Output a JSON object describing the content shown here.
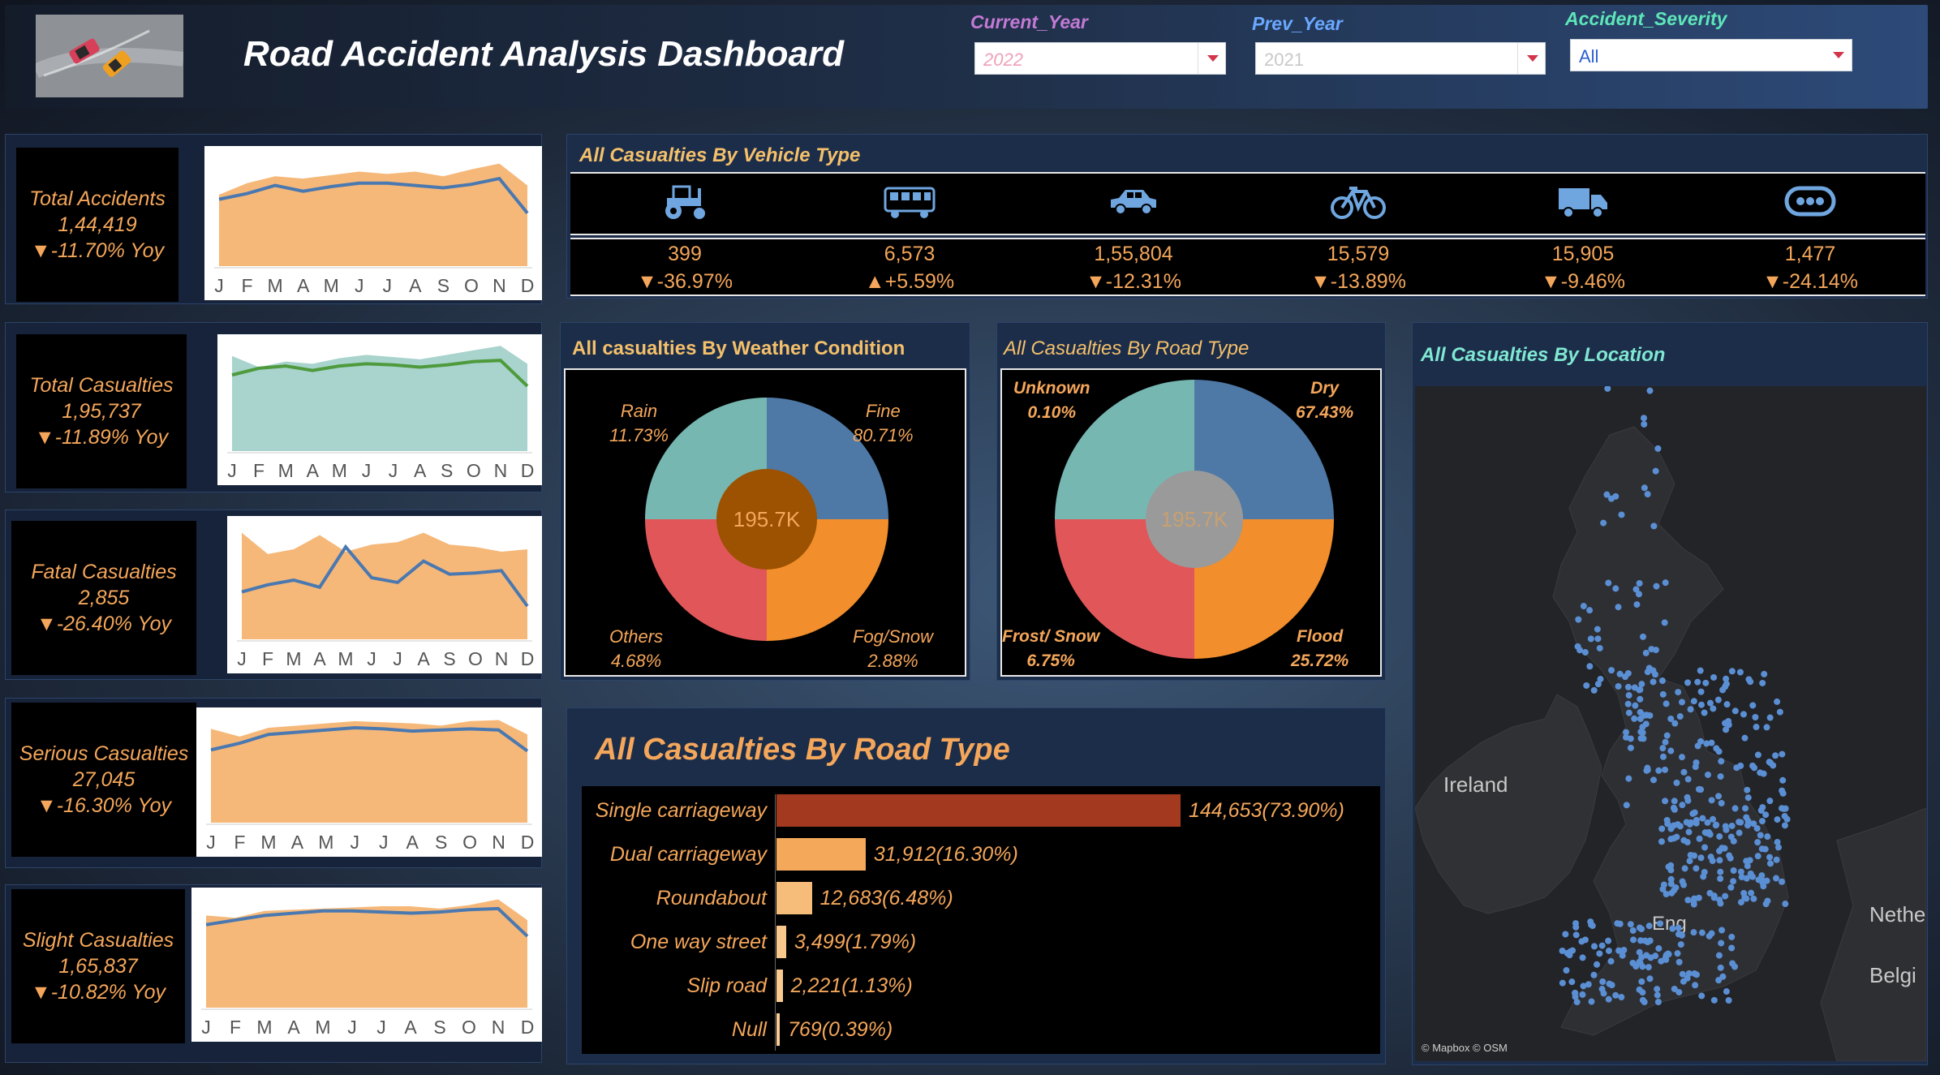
{
  "header": {
    "title": "Road Accident Analysis Dashboard",
    "filters": [
      {
        "label": "Current_Year",
        "value": "2022",
        "label_color": "#c37ad4",
        "value_color": "#f0a0b8"
      },
      {
        "label": "Prev_Year",
        "value": "2021",
        "label_color": "#6aa8ff",
        "value_color": "#c8c8c8"
      },
      {
        "label": "Accident_Severity",
        "value": "All",
        "label_color": "#5ee6b8",
        "value_color": "#2b5fd0"
      }
    ]
  },
  "months": [
    "J",
    "F",
    "M",
    "A",
    "M",
    "J",
    "J",
    "A",
    "S",
    "O",
    "N",
    "D"
  ],
  "kpis": [
    {
      "title": "Total Accidents",
      "value": "1,44,419",
      "change": "▼-11.70% Yoy",
      "area_color": "#f4b06a",
      "line_color": "#4a78b0",
      "area": [
        0.62,
        0.72,
        0.78,
        0.76,
        0.79,
        0.82,
        0.8,
        0.82,
        0.78,
        0.84,
        0.89,
        0.7
      ],
      "line": [
        0.58,
        0.63,
        0.7,
        0.65,
        0.69,
        0.72,
        0.72,
        0.7,
        0.68,
        0.71,
        0.76,
        0.46
      ]
    },
    {
      "title": "Total Casualties",
      "value": "1,95,737",
      "change": "▼-11.89% Yoy",
      "area_color": "#9fcfc8",
      "line_color": "#4e9a3c",
      "area": [
        0.85,
        0.75,
        0.8,
        0.78,
        0.83,
        0.86,
        0.84,
        0.82,
        0.86,
        0.9,
        0.94,
        0.78
      ],
      "line": [
        0.68,
        0.74,
        0.76,
        0.72,
        0.76,
        0.78,
        0.77,
        0.75,
        0.77,
        0.8,
        0.81,
        0.58
      ]
    },
    {
      "title": "Fatal Casualties",
      "value": "2,855",
      "change": "▼-26.40% Yoy",
      "area_color": "#f4b06a",
      "line_color": "#4a78b0",
      "area": [
        0.9,
        0.72,
        0.76,
        0.88,
        0.74,
        0.8,
        0.82,
        0.9,
        0.8,
        0.78,
        0.74,
        0.76
      ],
      "line": [
        0.4,
        0.46,
        0.5,
        0.44,
        0.78,
        0.52,
        0.48,
        0.66,
        0.55,
        0.56,
        0.58,
        0.28
      ]
    },
    {
      "title": "Serious Casualties",
      "value": "27,045",
      "change": "▼-16.30% Yoy",
      "area_color": "#f4b06a",
      "line_color": "#4a78b0",
      "area": [
        0.85,
        0.78,
        0.86,
        0.88,
        0.9,
        0.92,
        0.91,
        0.9,
        0.88,
        0.92,
        0.93,
        0.8
      ],
      "line": [
        0.66,
        0.72,
        0.8,
        0.82,
        0.84,
        0.86,
        0.85,
        0.83,
        0.84,
        0.85,
        0.84,
        0.65
      ]
    },
    {
      "title": "Slight Casualties",
      "value": "1,65,837",
      "change": "▼-10.82% Yoy",
      "area_color": "#f4b06a",
      "line_color": "#4a78b0",
      "area": [
        0.8,
        0.78,
        0.84,
        0.85,
        0.86,
        0.87,
        0.88,
        0.88,
        0.86,
        0.89,
        0.94,
        0.76
      ],
      "line": [
        0.72,
        0.76,
        0.8,
        0.82,
        0.84,
        0.84,
        0.83,
        0.82,
        0.83,
        0.85,
        0.86,
        0.62
      ]
    }
  ],
  "vehicles": {
    "title": "All  Casualties By Vehicle Type",
    "items": [
      {
        "icon": "tractor-icon",
        "value": "399",
        "change": "▼-36.97%"
      },
      {
        "icon": "bus-icon",
        "value": "6,573",
        "change": "▲+5.59%"
      },
      {
        "icon": "car-icon",
        "value": "1,55,804",
        "change": "▼-12.31%"
      },
      {
        "icon": "bicycle-icon",
        "value": "15,579",
        "change": "▼-13.89%"
      },
      {
        "icon": "truck-icon",
        "value": "15,905",
        "change": "▼-9.46%"
      },
      {
        "icon": "other-vehicle-icon",
        "value": "1,477",
        "change": "▼-24.14%"
      }
    ]
  },
  "weather": {
    "title": "All casualties By Weather Condition",
    "center": "195.7K",
    "labels": [
      {
        "name": "Rain",
        "pct": "11.73%"
      },
      {
        "name": "Fine",
        "pct": "80.71%"
      },
      {
        "name": "Others",
        "pct": "4.68%"
      },
      {
        "name": "Fog/Snow",
        "pct": "2.88%"
      }
    ]
  },
  "surface": {
    "title": "All Casualties By Road Type",
    "center": "195.7K",
    "labels": [
      {
        "name": "Unknown",
        "pct": "0.10%"
      },
      {
        "name": "Dry",
        "pct": "67.43%"
      },
      {
        "name": "Frost/ Snow",
        "pct": "6.75%"
      },
      {
        "name": "Flood",
        "pct": "25.72%"
      }
    ]
  },
  "road_type": {
    "title": "All  Casualties  By Road Type",
    "bars": [
      {
        "name": "Single carriageway",
        "value": 144653,
        "label": "144,653(73.90%)",
        "color": "#a33a1f"
      },
      {
        "name": "Dual carriageway",
        "value": 31912,
        "label": "31,912(16.30%)",
        "color": "#f4a85a"
      },
      {
        "name": "Roundabout",
        "value": 12683,
        "label": "12,683(6.48%)",
        "color": "#f6bc7a"
      },
      {
        "name": "One way street",
        "value": 3499,
        "label": "3,499(1.79%)",
        "color": "#f8c88c"
      },
      {
        "name": "Slip road",
        "value": 2221,
        "label": "2,221(1.13%)",
        "color": "#f8ca90"
      },
      {
        "name": "Null",
        "value": 769,
        "label": "769(0.39%)",
        "color": "#f8cc94"
      }
    ]
  },
  "location": {
    "title": "All  Casualties By Location",
    "labels": {
      "ireland": "Ireland",
      "england": "Eng",
      "nether": "Nethe",
      "belgium": "Belgi"
    },
    "credit": "© Mapbox © OSM"
  }
}
